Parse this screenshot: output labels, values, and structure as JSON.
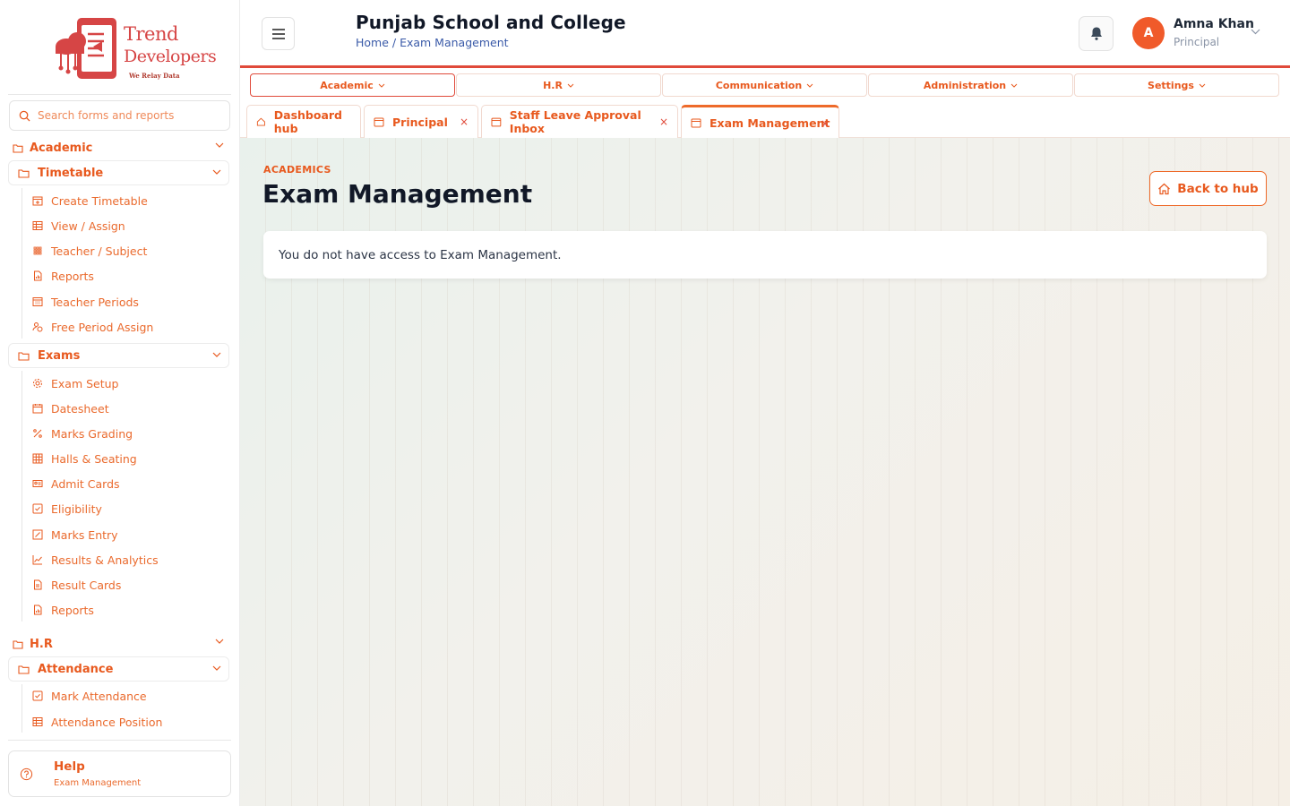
{
  "brand": {
    "line1": "Trend",
    "line2": "Developers",
    "tagline": "We Relay Data",
    "color": "#d64545"
  },
  "accent": "#e8591e",
  "sidebar": {
    "search_placeholder": "Search forms and reports",
    "academic_label": "Academic",
    "timetable_label": "Timetable",
    "timetable_items": [
      {
        "label": "Create Timetable",
        "icon": "calendar-plus-icon"
      },
      {
        "label": "View / Assign",
        "icon": "table-icon"
      },
      {
        "label": "Teacher / Subject",
        "icon": "grid-icon"
      },
      {
        "label": "Reports",
        "icon": "report-icon"
      },
      {
        "label": "Teacher Periods",
        "icon": "calendar-grid-icon"
      },
      {
        "label": "Free Period Assign",
        "icon": "user-clock-icon"
      }
    ],
    "exams_label": "Exams",
    "exams_items": [
      {
        "label": "Exam Setup",
        "icon": "gear-icon"
      },
      {
        "label": "Datesheet",
        "icon": "calendar-icon"
      },
      {
        "label": "Marks Grading",
        "icon": "percent-icon"
      },
      {
        "label": "Halls & Seating",
        "icon": "grid-icon"
      },
      {
        "label": "Admit Cards",
        "icon": "id-card-icon"
      },
      {
        "label": "Eligibility",
        "icon": "check-square-icon"
      },
      {
        "label": "Marks Entry",
        "icon": "edit-icon"
      },
      {
        "label": "Results & Analytics",
        "icon": "line-chart-icon"
      },
      {
        "label": "Result Cards",
        "icon": "document-icon"
      },
      {
        "label": "Reports",
        "icon": "report-icon"
      }
    ],
    "hr_label": "H.R",
    "attendance_label": "Attendance",
    "attendance_items": [
      {
        "label": "Mark Attendance",
        "icon": "check-square-icon"
      },
      {
        "label": "Attendance Position",
        "icon": "table-icon"
      }
    ],
    "help": {
      "title": "Help",
      "subtitle": "Exam Management"
    }
  },
  "header": {
    "school": "Punjab School and College",
    "breadcrumb": "Home / Exam Management",
    "user": {
      "initial": "A",
      "name": "Amna Khan",
      "role": "Principal"
    }
  },
  "modules": [
    "Academic",
    "H.R",
    "Communication",
    "Administration",
    "Settings"
  ],
  "tabs": [
    {
      "label": "Dashboard hub"
    },
    {
      "label": "Principal",
      "close": "×"
    },
    {
      "label": "Staff Leave Approval Inbox",
      "close": "×"
    },
    {
      "label": "Exam Management",
      "close": "×"
    }
  ],
  "main": {
    "eyebrow": "ACADEMICS",
    "title": "Exam Management",
    "back_label": "Back to hub",
    "message": "You do not have access to Exam Management."
  }
}
